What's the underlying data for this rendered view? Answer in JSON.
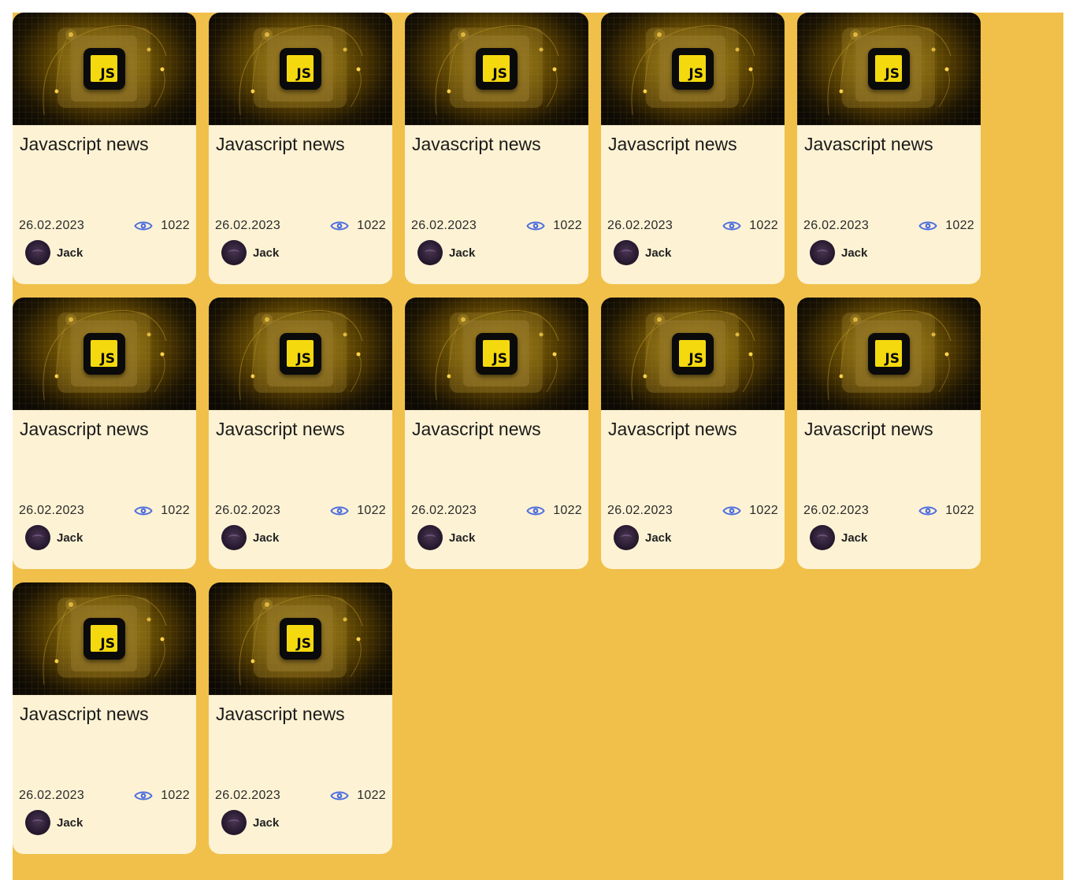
{
  "colors": {
    "background": "#f0c04a",
    "card": "#fdf2d4",
    "accent_eye": "#4f6fe0",
    "js_yellow": "#f5d90f"
  },
  "cards": [
    {
      "title": "Javascript news",
      "date": "26.02.2023",
      "views": "1022",
      "author": "Jack",
      "logo_text": "JS"
    },
    {
      "title": "Javascript news",
      "date": "26.02.2023",
      "views": "1022",
      "author": "Jack",
      "logo_text": "JS"
    },
    {
      "title": "Javascript news",
      "date": "26.02.2023",
      "views": "1022",
      "author": "Jack",
      "logo_text": "JS"
    },
    {
      "title": "Javascript news",
      "date": "26.02.2023",
      "views": "1022",
      "author": "Jack",
      "logo_text": "JS"
    },
    {
      "title": "Javascript news",
      "date": "26.02.2023",
      "views": "1022",
      "author": "Jack",
      "logo_text": "JS"
    },
    {
      "title": "Javascript news",
      "date": "26.02.2023",
      "views": "1022",
      "author": "Jack",
      "logo_text": "JS"
    },
    {
      "title": "Javascript news",
      "date": "26.02.2023",
      "views": "1022",
      "author": "Jack",
      "logo_text": "JS"
    },
    {
      "title": "Javascript news",
      "date": "26.02.2023",
      "views": "1022",
      "author": "Jack",
      "logo_text": "JS"
    },
    {
      "title": "Javascript news",
      "date": "26.02.2023",
      "views": "1022",
      "author": "Jack",
      "logo_text": "JS"
    },
    {
      "title": "Javascript news",
      "date": "26.02.2023",
      "views": "1022",
      "author": "Jack",
      "logo_text": "JS"
    },
    {
      "title": "Javascript news",
      "date": "26.02.2023",
      "views": "1022",
      "author": "Jack",
      "logo_text": "JS"
    },
    {
      "title": "Javascript news",
      "date": "26.02.2023",
      "views": "1022",
      "author": "Jack",
      "logo_text": "JS"
    }
  ]
}
